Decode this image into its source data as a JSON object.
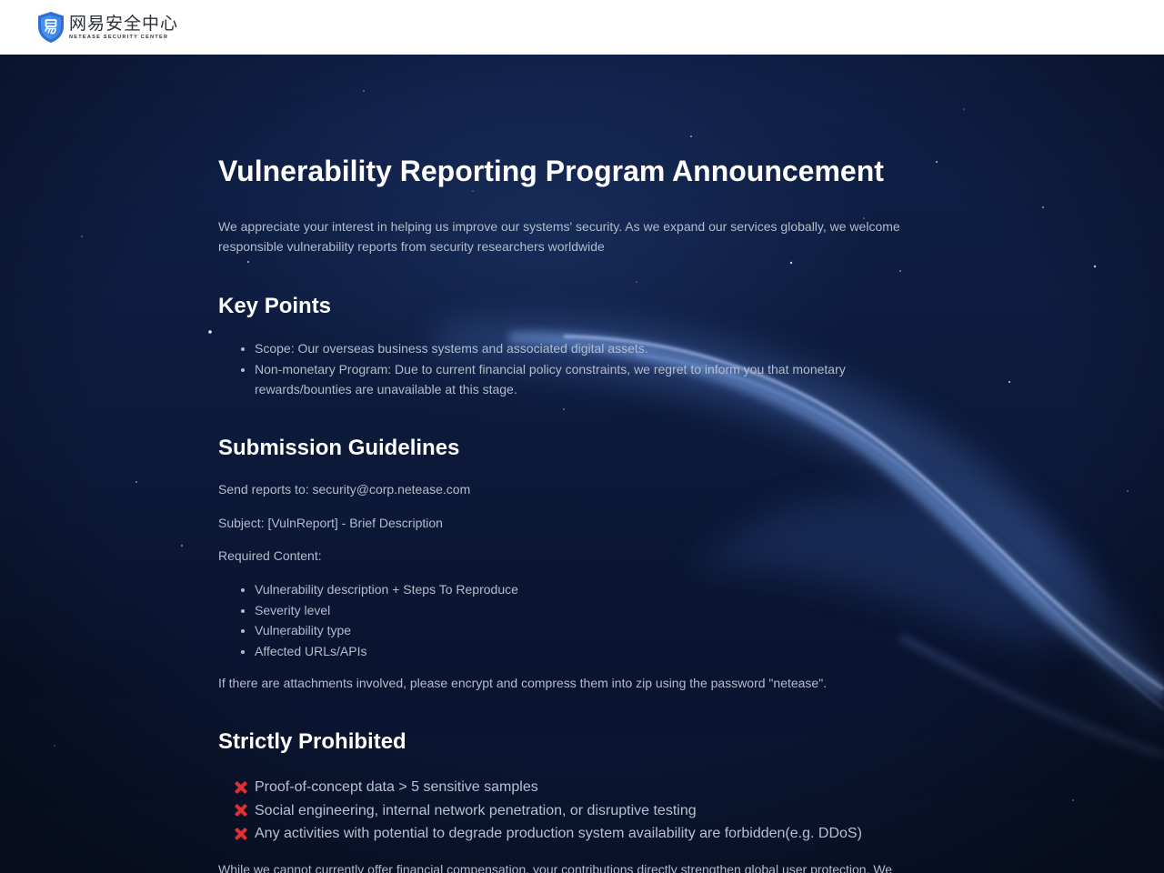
{
  "header": {
    "logo_cn": "网易安全中心",
    "logo_en": "NETEASE SECURITY CENTER",
    "logo_icon": "shield-icon"
  },
  "colors": {
    "header_bg": "#ffffff",
    "page_bg": "#0c1a3a",
    "heading": "#ffffff",
    "body_text": "#b4bccb",
    "cross_mark": "#e0312f",
    "shield_blue": "#2d6fd6"
  },
  "page": {
    "title": "Vulnerability Reporting Program Announcement",
    "intro": "We appreciate your interest in helping us improve our systems' security. As we expand our services globally, we welcome responsible vulnerability reports from security researchers worldwide",
    "key_points": {
      "heading": "Key Points",
      "items": [
        "Scope: Our overseas business systems and associated digital assets.",
        "Non-monetary Program: Due to current financial policy constraints, we regret to inform you that monetary rewards/bounties are unavailable at this stage."
      ]
    },
    "submission": {
      "heading": "Submission Guidelines",
      "send_to": "Send reports to: security@corp.netease.com",
      "subject": "Subject: [VulnReport] - Brief Description",
      "required_label": "Required Content:",
      "required_items": [
        "Vulnerability description + Steps To Reproduce",
        "Severity level",
        "Vulnerability type",
        "Affected URLs/APIs"
      ],
      "attachments_note": "If there are attachments involved, please encrypt and compress them into zip using the password \"netease\"."
    },
    "prohibited": {
      "heading": "Strictly Prohibited",
      "icon": "cross-mark-icon",
      "items": [
        "Proof-of-concept data > 5 sensitive samples",
        "Social engineering, internal network penetration, or disruptive testing",
        "Any activities with potential to degrade production system availability are forbidden(e.g. DDoS)"
      ]
    },
    "closing": "While we cannot currently offer financial compensation, your contributions directly strengthen global user protection. We"
  }
}
